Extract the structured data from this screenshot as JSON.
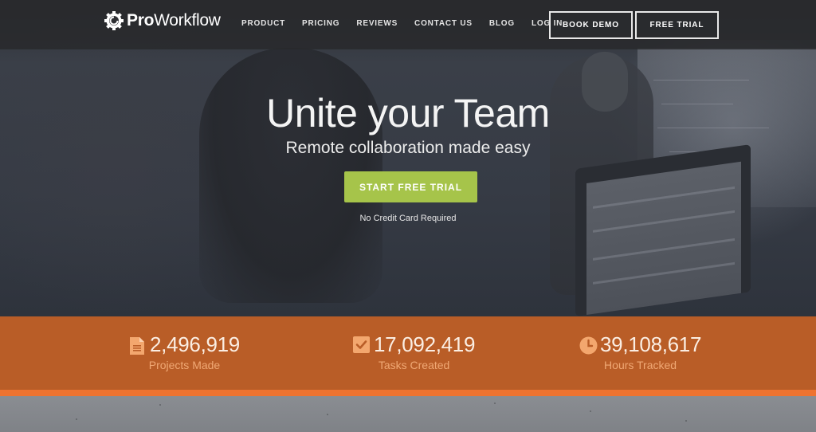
{
  "nav": {
    "logo_bold": "Pro",
    "logo_light": "Workflow",
    "links": [
      "PRODUCT",
      "PRICING",
      "REVIEWS",
      "CONTACT US",
      "BLOG",
      "LOG IN"
    ],
    "book_demo_label": "BOOK DEMO",
    "free_trial_label": "FREE TRIAL"
  },
  "hero": {
    "headline": "Unite your Team",
    "subheadline": "Remote collaboration made easy",
    "cta_label": "START FREE TRIAL",
    "cta_note": "No Credit Card Required",
    "cta_color": "#a6c44a"
  },
  "stats": {
    "background_color": "#b95d27",
    "accent_color": "#ee7330",
    "items": [
      {
        "icon": "document-icon",
        "value": "2,496,919",
        "label": "Projects Made"
      },
      {
        "icon": "checkbox-icon",
        "value": "17,092,419",
        "label": "Tasks Created"
      },
      {
        "icon": "clock-icon",
        "value": "39,108,617",
        "label": "Hours Tracked"
      }
    ]
  }
}
